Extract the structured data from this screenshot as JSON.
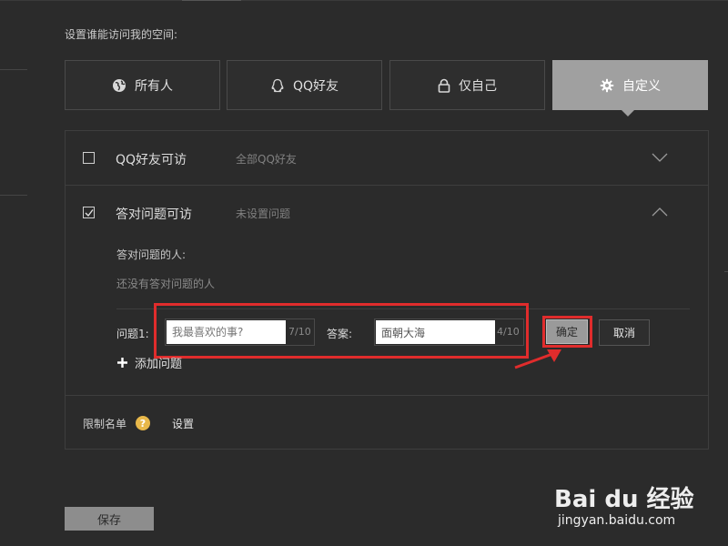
{
  "heading": "设置谁能访问我的空间:",
  "tabs": [
    {
      "label": "所有人",
      "icon": "globe-icon"
    },
    {
      "label": "QQ好友",
      "icon": "qq-penguin-icon"
    },
    {
      "label": "仅自己",
      "icon": "lock-icon"
    },
    {
      "label": "自定义",
      "icon": "gear-icon",
      "active": true
    }
  ],
  "rows": {
    "friends": {
      "label": "QQ好友可访",
      "hint": "全部QQ好友",
      "checked": false
    },
    "question": {
      "label": "答对问题可访",
      "hint": "未设置问题",
      "checked": true
    }
  },
  "answered": {
    "label": "答对问题的人:",
    "empty_text": "还没有答对问题的人"
  },
  "question_form": {
    "question_label": "问题1:",
    "question_placeholder": "我最喜欢的事?",
    "question_counter": "7/10",
    "answer_label": "答案:",
    "answer_value": "面朝大海",
    "answer_counter": "4/10",
    "confirm": "确定",
    "cancel": "取消"
  },
  "add_question": "添加问题",
  "restrict": {
    "label": "限制名单",
    "action": "设置"
  },
  "save": "保存",
  "watermark": {
    "brand": "Bai du 经验",
    "url": "jingyan.baidu.com"
  },
  "colors": {
    "highlight": "#e02c2c",
    "active_tab": "#a0a0a0",
    "help_badge": "#e8b84a"
  }
}
